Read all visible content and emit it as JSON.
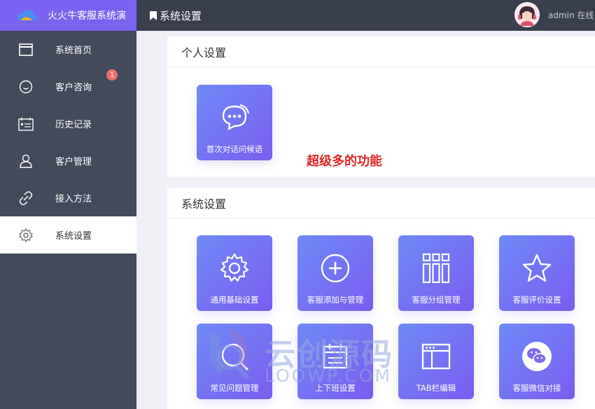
{
  "app": {
    "name": "火火牛客服系统演"
  },
  "colors": {
    "sidebar": "#434a5c",
    "brand": "#7a63f0",
    "header": "#3a3f4e",
    "tile_start": "#6e8bf7",
    "tile_end": "#7b5cf0",
    "badge": "#f56c6c",
    "promo": "#e12727"
  },
  "sidebar": {
    "items": [
      {
        "label": "系统首页",
        "icon": "window-icon"
      },
      {
        "label": "客户咨询",
        "icon": "chat-bubble-icon",
        "badge": "1"
      },
      {
        "label": "历史记录",
        "icon": "calendar-list-icon"
      },
      {
        "label": "客户管理",
        "icon": "user-icon"
      },
      {
        "label": "接入方法",
        "icon": "link-icon"
      },
      {
        "label": "系统设置",
        "icon": "gear-icon"
      }
    ]
  },
  "header": {
    "title": "系统设置",
    "user": "admin 在线"
  },
  "personal": {
    "title": "个人设置",
    "tiles": [
      {
        "label": "首次对话问候语",
        "icon": "chat-dots-icon"
      }
    ],
    "promo": "超级多的功能"
  },
  "system": {
    "title": "系统设置",
    "tiles": [
      {
        "label": "通用基础设置",
        "icon": "gear-icon"
      },
      {
        "label": "客服添加与管理",
        "icon": "plus-circle-icon"
      },
      {
        "label": "客服分组管理",
        "icon": "grid-icon"
      },
      {
        "label": "客服评价设置",
        "icon": "star-icon"
      },
      {
        "label": "常见问题管理",
        "icon": "help-icon"
      },
      {
        "label": "上下班设置",
        "icon": "clock-icon"
      },
      {
        "label": "TAB栏编辑",
        "icon": "browser-icon"
      },
      {
        "label": "客服微信对接",
        "icon": "wechat-icon"
      }
    ]
  },
  "watermark": {
    "cn": "云创源码",
    "en": "LOOWP.COM"
  }
}
